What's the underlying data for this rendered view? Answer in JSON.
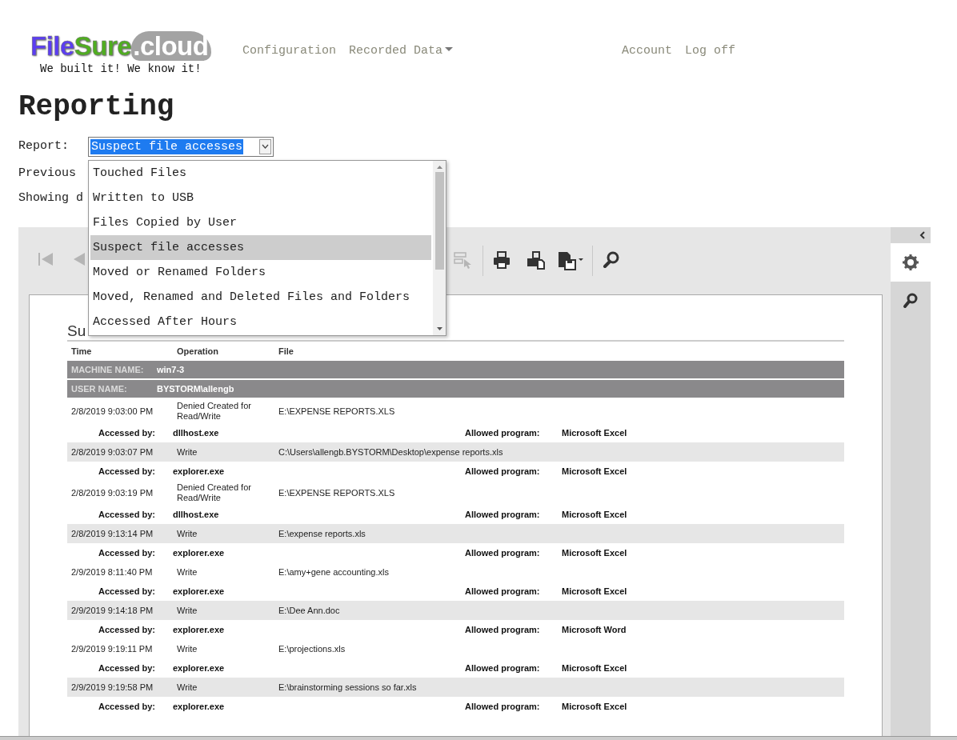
{
  "header": {
    "logo": {
      "parts": [
        "File",
        "Sure",
        ".cloud"
      ],
      "tagline": "We built it! We know it!"
    },
    "menu": [
      {
        "label": "Configuration",
        "has_caret": false
      },
      {
        "label": "Recorded Data",
        "has_caret": true
      }
    ],
    "account_links": [
      "Account",
      "Log off"
    ]
  },
  "page_title": "Reporting",
  "report_field": {
    "label": "Report:",
    "value": "Suspect file accesses",
    "expanded": true,
    "options": [
      {
        "label": "Touched Files",
        "selected": false
      },
      {
        "label": "Written to USB",
        "selected": false
      },
      {
        "label": "Files Copied by User",
        "selected": false
      },
      {
        "label": "Suspect file accesses",
        "selected": true
      },
      {
        "label": "Moved or Renamed Folders",
        "selected": false
      },
      {
        "label": "Moved, Renamed and Deleted Files and Folders",
        "selected": false
      },
      {
        "label": "Accessed After Hours",
        "selected": false
      }
    ]
  },
  "lines": [
    "Previous",
    "Showing d"
  ],
  "viewer": {
    "toolbar": [
      {
        "disabled": true
      },
      {
        "disabled": true
      },
      {
        "disabled": true
      },
      {
        "disabled": false
      },
      {
        "disabled": false
      },
      {
        "disabled": false
      },
      {
        "disabled": false
      }
    ],
    "side_tabs": [
      {
        "selected": true
      },
      {
        "selected": false
      }
    ],
    "report": {
      "title": "Su",
      "columns": [
        "Time",
        "Operation",
        "File"
      ],
      "groups": [
        {
          "label": "MACHINE NAME:",
          "value": "win7-3"
        },
        {
          "label": "USER NAME:",
          "value": "BYSTORM\\allengb"
        }
      ],
      "entries": [
        {
          "time": "2/8/2019 9:03:00 PM",
          "operation": "Denied Created for Read/Write",
          "file": "E:\\EXPENSE REPORTS.XLS",
          "accessed_label": "Accessed by:",
          "accessed_by": "dllhost.exe",
          "allowed_label": "Allowed program:",
          "allowed_program": "Microsoft Excel"
        },
        {
          "time": "2/8/2019 9:03:07 PM",
          "operation": "Write",
          "file": "C:\\Users\\allengb.BYSTORM\\Desktop\\expense reports.xls",
          "accessed_label": "Accessed by:",
          "accessed_by": "explorer.exe",
          "allowed_label": "Allowed program:",
          "allowed_program": "Microsoft Excel"
        },
        {
          "time": "2/8/2019 9:03:19 PM",
          "operation": "Denied Created for Read/Write",
          "file": "E:\\EXPENSE REPORTS.XLS",
          "accessed_label": "Accessed by:",
          "accessed_by": "dllhost.exe",
          "allowed_label": "Allowed program:",
          "allowed_program": "Microsoft Excel"
        },
        {
          "time": "2/8/2019 9:13:14 PM",
          "operation": "Write",
          "file": "E:\\expense reports.xls",
          "accessed_label": "Accessed by:",
          "accessed_by": "explorer.exe",
          "allowed_label": "Allowed program:",
          "allowed_program": "Microsoft Excel"
        },
        {
          "time": "2/9/2019 8:11:40 PM",
          "operation": "Write",
          "file": "E:\\amy+gene accounting.xls",
          "accessed_label": "Accessed by:",
          "accessed_by": "explorer.exe",
          "allowed_label": "Allowed program:",
          "allowed_program": "Microsoft Excel"
        },
        {
          "time": "2/9/2019 9:14:18 PM",
          "operation": "Write",
          "file": "E:\\Dee Ann.doc",
          "accessed_label": "Accessed by:",
          "accessed_by": "explorer.exe",
          "allowed_label": "Allowed program:",
          "allowed_program": "Microsoft Word"
        },
        {
          "time": "2/9/2019 9:19:11 PM",
          "operation": "Write",
          "file": "E:\\projections.xls",
          "accessed_label": "Accessed by:",
          "accessed_by": "explorer.exe",
          "allowed_label": "Allowed program:",
          "allowed_program": "Microsoft Excel"
        },
        {
          "time": "2/9/2019 9:19:58 PM",
          "operation": "Write",
          "file": "E:\\brainstorming sessions so far.xls",
          "accessed_label": "Accessed by:",
          "accessed_by": "explorer.exe",
          "allowed_label": "Allowed program:",
          "allowed_program": "Microsoft Excel"
        }
      ]
    }
  }
}
